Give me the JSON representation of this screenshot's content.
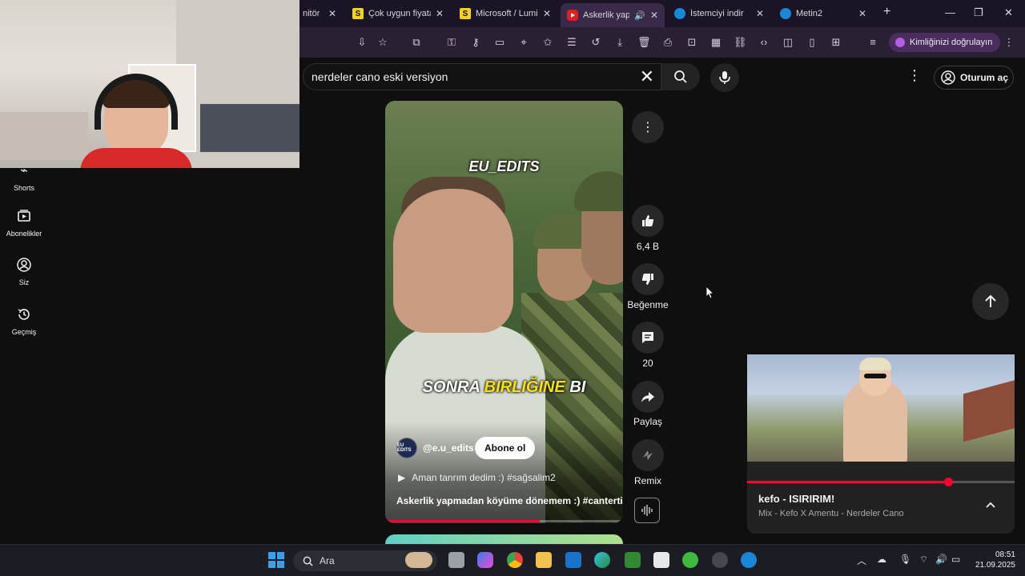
{
  "browser": {
    "tabs": [
      {
        "label": "nitör",
        "favicon": "none"
      },
      {
        "label": "Çok uygun fiyata",
        "favicon": "s-icon"
      },
      {
        "label": "Microsoft / Lumi",
        "favicon": "s-icon"
      },
      {
        "label": "Askerlik yapı",
        "favicon": "youtube-icon",
        "active": true
      },
      {
        "label": "İstemciyi indir",
        "favicon": "edge-icon"
      },
      {
        "label": "Metin2",
        "favicon": "edge-icon"
      }
    ],
    "tab_close_glyph": "✕",
    "new_tab_glyph": "+",
    "verify_label": "Kimliğinizi doğrulayın"
  },
  "youtube": {
    "nav": [
      {
        "label": "Shorts",
        "icon": "shorts-icon"
      },
      {
        "label": "Abonelikler",
        "icon": "subscriptions-icon"
      },
      {
        "label": "Siz",
        "icon": "user-icon"
      },
      {
        "label": "Geçmiş",
        "icon": "history-icon"
      }
    ],
    "search": {
      "query": "nerdeler cano eski versiyon",
      "clear_glyph": "✕"
    },
    "signin_label": "Oturum aç",
    "short": {
      "brand_overlay": "EU_EDITS",
      "caption_parts": [
        "SONRA ",
        "BIRLIĞINE",
        " BI"
      ],
      "channel_avatar_text": "EU EDITS",
      "channel_handle": "@e.u_edits",
      "subscribe_label": "Abone ol",
      "music_line": "Aman tanrım dedim :) #sağsalim2",
      "title": "Askerlik yapmadan köyüme dönemem :) #cantertip",
      "progress_fraction": 0.65
    },
    "actions": {
      "like_count": "6,4 B",
      "dislike_label": "Beğenme",
      "comment_count": "20",
      "share_label": "Paylaş",
      "remix_label": "Remix"
    },
    "mini_player": {
      "title": "kefo - ISIRIRIM!",
      "subtitle": "Mix - Kefo X Amentu - Nerdeler Cano",
      "progress_fraction": 0.75
    }
  },
  "taskbar": {
    "search_placeholder": "Ara",
    "time": "08:51",
    "date": "21.09.2025"
  },
  "colors": {
    "accent_red": "#ff0033",
    "youtube_bg": "#0f0f0f",
    "browser_bg": "#1b1426"
  }
}
